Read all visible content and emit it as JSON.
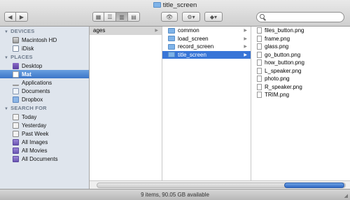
{
  "window": {
    "title": "title_screen"
  },
  "toolbar": {
    "back_label": "◀",
    "forward_label": "▶",
    "views": [
      "icon-view",
      "list-view",
      "column-view",
      "coverflow-view"
    ],
    "search": {
      "value": "",
      "placeholder": ""
    }
  },
  "sidebar": {
    "sections": [
      {
        "title": "DEVICES",
        "items": [
          {
            "label": "Macintosh HD",
            "icon": "hard-disk-icon"
          },
          {
            "label": "iDisk",
            "icon": "idisk-icon"
          }
        ]
      },
      {
        "title": "PLACES",
        "items": [
          {
            "label": "Desktop",
            "icon": "desktop-icon"
          },
          {
            "label": "Mat",
            "icon": "home-icon",
            "selected": true
          },
          {
            "label": "Applications",
            "icon": "applications-icon"
          },
          {
            "label": "Documents",
            "icon": "documents-icon"
          },
          {
            "label": "Dropbox",
            "icon": "dropbox-icon"
          }
        ]
      },
      {
        "title": "SEARCH FOR",
        "items": [
          {
            "label": "Today",
            "icon": "clock-icon"
          },
          {
            "label": "Yesterday",
            "icon": "clock-icon"
          },
          {
            "label": "Past Week",
            "icon": "clock-icon"
          },
          {
            "label": "All Images",
            "icon": "smart-folder-icon"
          },
          {
            "label": "All Movies",
            "icon": "smart-folder-icon"
          },
          {
            "label": "All Documents",
            "icon": "smart-folder-icon"
          }
        ]
      }
    ]
  },
  "columns": {
    "col1": [
      {
        "label": "ages",
        "folder": true
      }
    ],
    "col2": [
      {
        "label": "common",
        "folder": true
      },
      {
        "label": "load_screen",
        "folder": true
      },
      {
        "label": "record_screen",
        "folder": true
      },
      {
        "label": "title_screen",
        "folder": true,
        "selected": true
      }
    ],
    "col3": [
      {
        "label": "files_button.png"
      },
      {
        "label": "frame.png"
      },
      {
        "label": "glass.png"
      },
      {
        "label": "go_button.png"
      },
      {
        "label": "how_button.png"
      },
      {
        "label": "L_speaker.png"
      },
      {
        "label": "photo.png"
      },
      {
        "label": "R_speaker.png"
      },
      {
        "label": "TRIM.png"
      }
    ]
  },
  "status": {
    "text": "9 items, 90.05 GB available"
  }
}
